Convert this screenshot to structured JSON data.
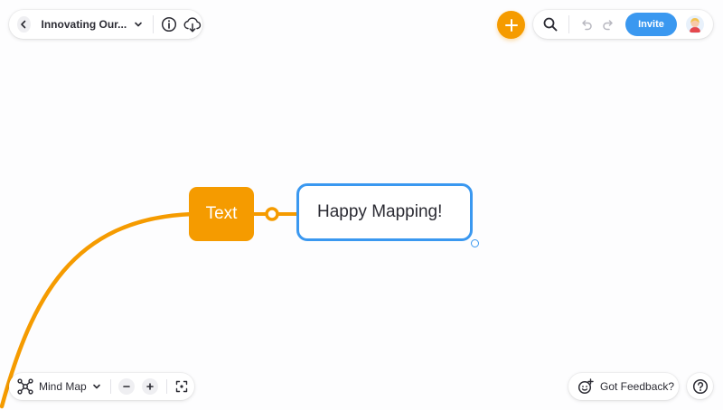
{
  "header": {
    "title": "Innovating Our...",
    "invite_label": "Invite"
  },
  "canvas": {
    "topic_text": "Text",
    "subtopic_text": "Happy Mapping!",
    "colors": {
      "branch": "#f59b00",
      "topic_fill": "#f59b00",
      "selection": "#3a98f0"
    }
  },
  "toolbar": {
    "view_label": "Mind Map",
    "feedback_label": "Got Feedback?"
  },
  "icons": {
    "back": "chevron-left-icon",
    "dropdown": "chevron-down-icon",
    "info": "info-icon",
    "download": "cloud-download-icon",
    "add": "plus-icon",
    "search": "search-icon",
    "undo": "undo-icon",
    "redo": "redo-icon",
    "view": "mind-map-icon",
    "zoom_out": "minus-icon",
    "zoom_in": "plus-icon",
    "fit": "fit-screen-icon",
    "feedback": "feedback-icon",
    "help": "help-icon"
  }
}
